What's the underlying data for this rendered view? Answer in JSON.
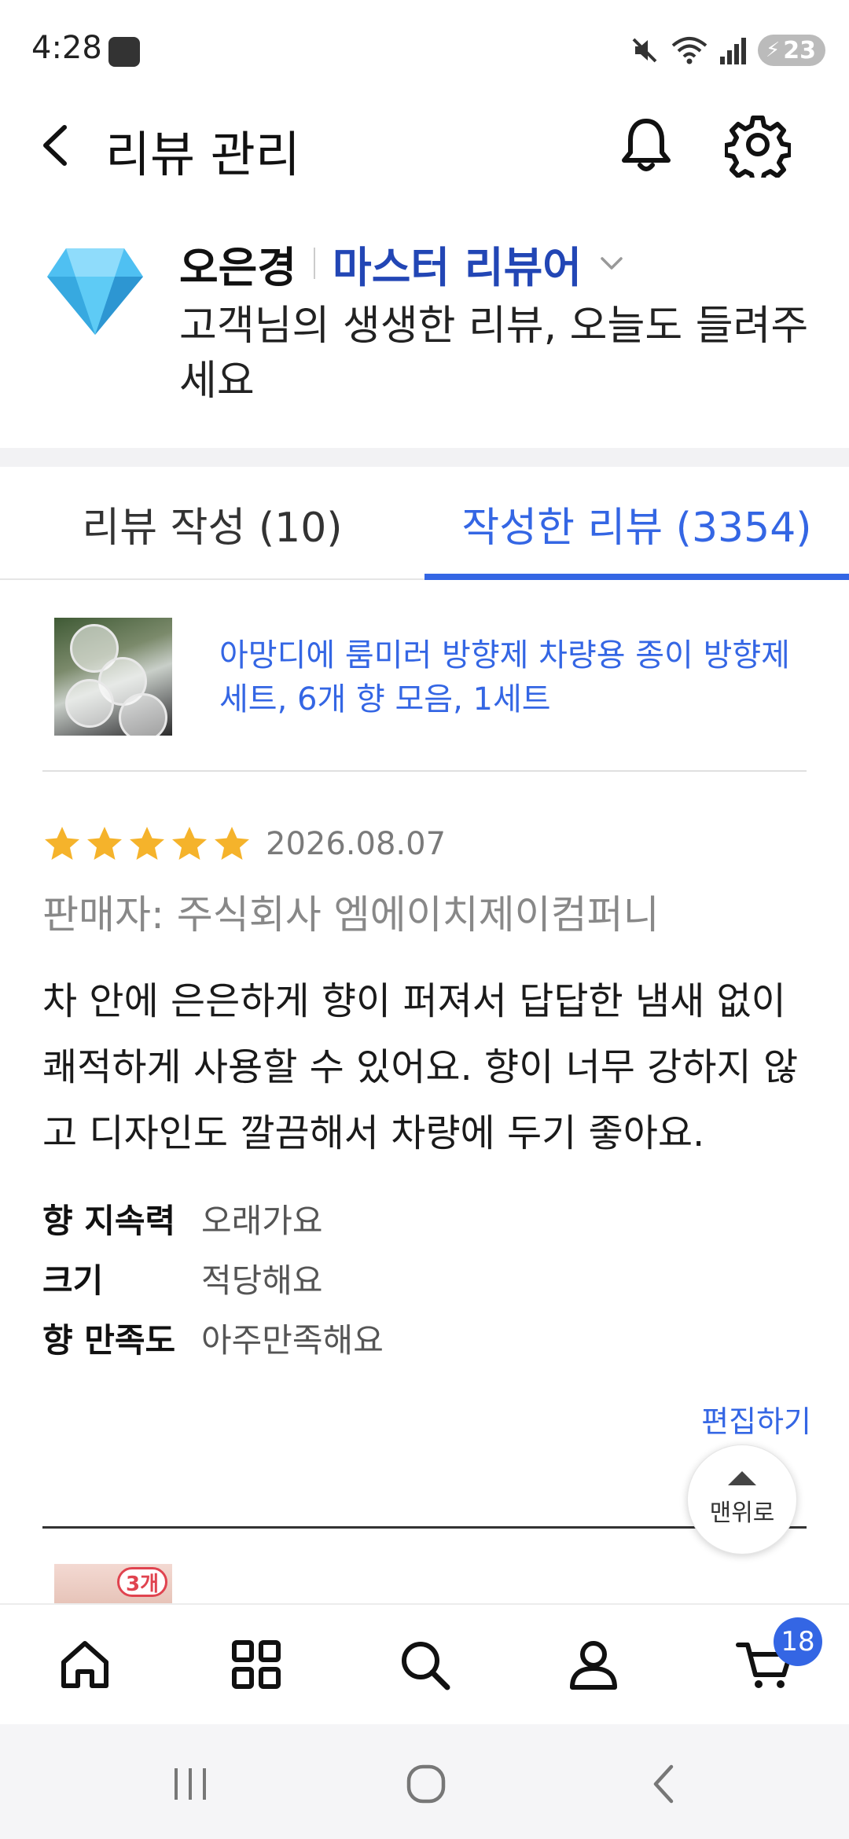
{
  "status_bar": {
    "time": "4:28",
    "battery": "23",
    "icons": [
      "app-badge-icon",
      "mute-icon",
      "wifi-icon",
      "signal-icon",
      "battery-icon"
    ]
  },
  "header": {
    "title": "리뷰 관리",
    "icons": [
      "back-arrow-icon",
      "bell-icon",
      "gear-icon"
    ]
  },
  "profile": {
    "name": "오은경",
    "grade": "마스터 리뷰어",
    "message": "고객님의 생생한 리뷰, 오늘도 들려주세요",
    "badge_icon": "diamond-icon"
  },
  "tabs": [
    {
      "label": "리뷰 작성 (10)",
      "active": false
    },
    {
      "label": "작성한 리뷰 (3354)",
      "active": true
    }
  ],
  "review": {
    "product_name": "아망디에 룸미러 방향제 차량용 종이 방향제 세트, 6개 향 모음, 1세트",
    "rating": 5,
    "rating_max": 5,
    "date": "2026.08.07",
    "seller": "판매자: 주식회사 엠에이치제이컴퍼니",
    "text": "차 안에 은은하게 향이 퍼져서 답답한 냄새 없이 쾌적하게 사용할 수 있어요. 향이 너무 강하지 않고 디자인도 깔끔해서 차량에 두기 좋아요.",
    "attributes": [
      {
        "label": "향 지속력",
        "value": "오래가요"
      },
      {
        "label": "크기",
        "value": "적당해요"
      },
      {
        "label": "향 만족도",
        "value": "아주만족해요"
      }
    ],
    "edit_label": "편집하기"
  },
  "next_review": {
    "thumb_badge": "3개"
  },
  "scroll_top": {
    "label": "맨위로"
  },
  "bottom_nav": {
    "items": [
      "home-icon",
      "categories-icon",
      "search-icon",
      "my-page-icon",
      "cart-icon"
    ],
    "cart_count": "18"
  },
  "system_nav": {
    "items": [
      "recent-apps-icon",
      "home-circle-icon",
      "system-back-icon"
    ]
  },
  "colors": {
    "accent": "#3466e4",
    "grade": "#2246b5",
    "star": "#f5b32b",
    "diamond": "#4fc0f2"
  }
}
